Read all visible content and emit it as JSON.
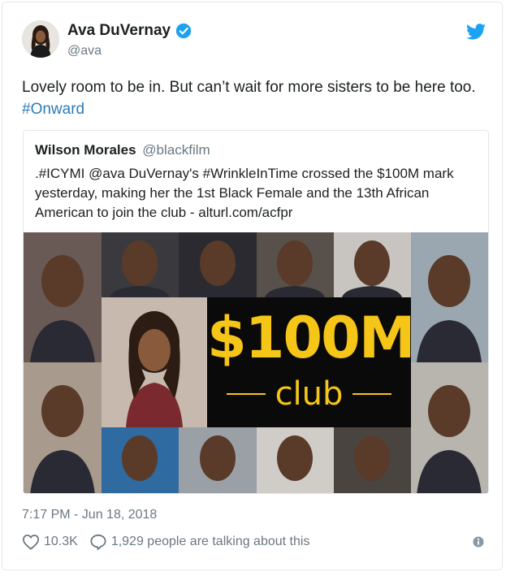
{
  "author": {
    "name": "Ava DuVernay",
    "handle": "@ava"
  },
  "tweet": {
    "text": "Lovely room to be in. But can’t wait for more sisters to be here too. ",
    "hashtag": "#Onward"
  },
  "quoted": {
    "name": "Wilson Morales",
    "handle": "@blackfilm",
    "text": ".#ICYMI @ava DuVernay's #WrinkleInTime crossed the $100M mark yesterday, making her the 1st Black Female and the 13th African American to join the club - alturl.com/acfpr",
    "image": {
      "headline": "$100M",
      "subline": "club"
    }
  },
  "meta": {
    "timestamp": "7:17 PM - Jun 18, 2018",
    "likes": "10.3K",
    "conversation": "1,929 people are talking about this"
  },
  "colors": {
    "link": "#2b7bb9",
    "verified": "#1da1f2",
    "muted": "#697882",
    "gold": "#f5c518"
  },
  "icons": [
    "verified-badge-icon",
    "twitter-bird-icon",
    "heart-icon",
    "speech-bubble-icon",
    "info-icon"
  ]
}
